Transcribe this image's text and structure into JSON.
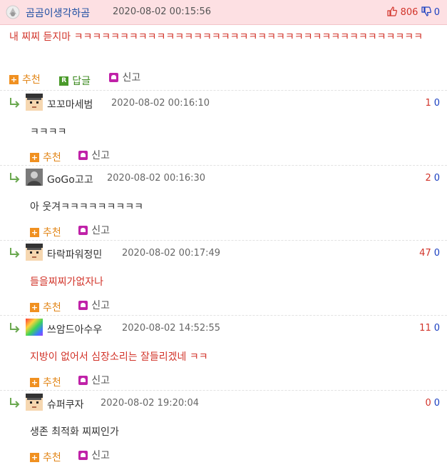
{
  "post": {
    "author": "곰곰이생각하곰",
    "date": "2020-08-02 00:15:56",
    "upvotes": "806",
    "downvotes": "0",
    "body": "내 찌찌 듣지마 ㅋㅋㅋㅋㅋㅋㅋㅋㅋㅋㅋㅋㅋㅋㅋㅋㅋㅋㅋㅋㅋㅋㅋㅋㅋㅋㅋㅋㅋㅋㅋㅋㅋㅋㅋㅋㅋㅋ",
    "actions": {
      "recommend": "추천",
      "reply": "답글",
      "report": "신고"
    },
    "reply_icon_letter": "R"
  },
  "comments": [
    {
      "author": "꼬꼬마세범",
      "date": "2020-08-02 00:16:10",
      "up": "1",
      "down": "0",
      "text": "ㅋㅋㅋㅋ",
      "text_color": "plain",
      "avatar": "pixel-face-icon"
    },
    {
      "author": "GoGo고고",
      "date": "2020-08-02 00:16:30",
      "up": "2",
      "down": "0",
      "text": "아 웃겨ㅋㅋㅋㅋㅋㅋㅋㅋㅋ",
      "text_color": "plain",
      "avatar": "photo-avatar-icon"
    },
    {
      "author": "타락파워정민",
      "date": "2020-08-02 00:17:49",
      "up": "47",
      "down": "0",
      "text": "들을찌찌가없자나",
      "text_color": "red",
      "avatar": "pixel-face-icon"
    },
    {
      "author": "쓰암드아수우",
      "date": "2020-08-02 14:52:55",
      "up": "11",
      "down": "0",
      "text": "지방이 없어서 심장소리는 잘들리겠네 ㅋㅋ",
      "text_color": "red",
      "avatar": "rainbow-avatar-icon"
    },
    {
      "author": "슈퍼쿠자",
      "date": "2020-08-02 19:20:04",
      "up": "0",
      "down": "0",
      "text": "생존 최적화 찌찌인가",
      "text_color": "plain",
      "avatar": "pixel-face-icon"
    }
  ],
  "comment_actions": {
    "recommend": "추천",
    "report": "신고"
  },
  "colors": {
    "header_bg": "#fde0e3",
    "accent_red": "#d2342a",
    "accent_blue": "#1a3fc0",
    "author_blue": "#1f4fa3"
  }
}
